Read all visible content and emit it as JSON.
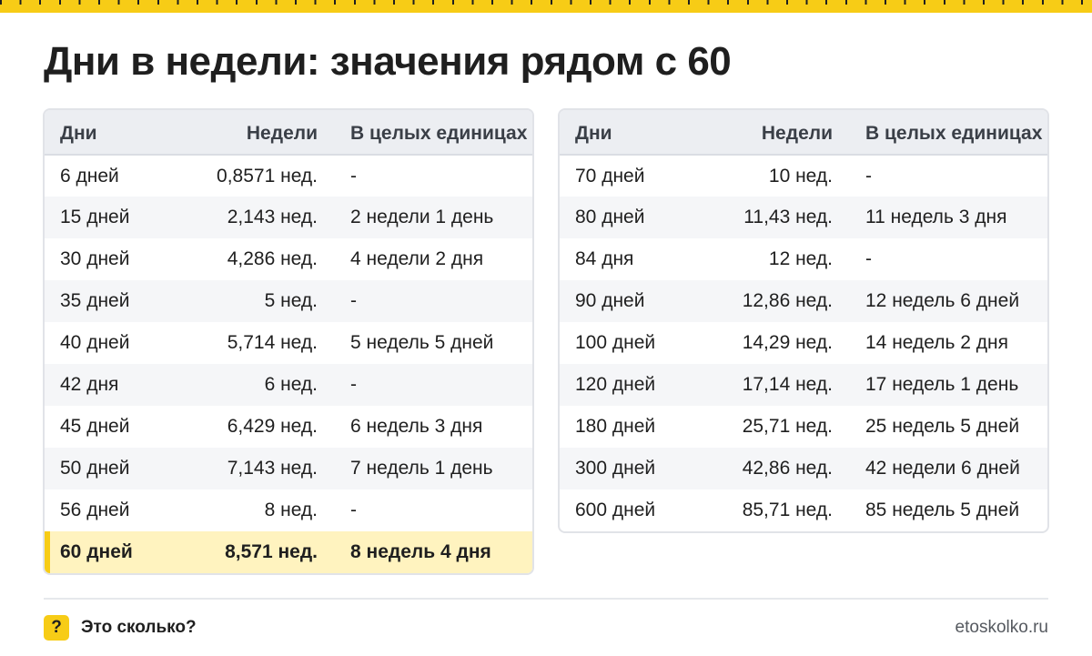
{
  "title": "Дни в недели: значения рядом с 60",
  "headers": [
    "Дни",
    "Недели",
    "В целых единицах"
  ],
  "left_rows": [
    [
      "6 дней",
      "0,8571 нед.",
      "-"
    ],
    [
      "15 дней",
      "2,143 нед.",
      "2 недели 1 день"
    ],
    [
      "30 дней",
      "4,286 нед.",
      "4 недели 2 дня"
    ],
    [
      "35 дней",
      "5 нед.",
      "-"
    ],
    [
      "40 дней",
      "5,714 нед.",
      "5 недель 5 дней"
    ],
    [
      "42 дня",
      "6 нед.",
      "-"
    ],
    [
      "45 дней",
      "6,429 нед.",
      "6 недель 3 дня"
    ],
    [
      "50 дней",
      "7,143 нед.",
      "7 недель 1 день"
    ],
    [
      "56 дней",
      "8 нед.",
      "-"
    ],
    [
      "60 дней",
      "8,571 нед.",
      "8 недель 4 дня"
    ]
  ],
  "right_rows": [
    [
      "70 дней",
      "10 нед.",
      "-"
    ],
    [
      "80 дней",
      "11,43 нед.",
      "11 недель 3 дня"
    ],
    [
      "84 дня",
      "12 нед.",
      "-"
    ],
    [
      "90 дней",
      "12,86 нед.",
      "12 недель 6 дней"
    ],
    [
      "100 дней",
      "14,29 нед.",
      "14 недель 2 дня"
    ],
    [
      "120 дней",
      "17,14 нед.",
      "17 недель 1 день"
    ],
    [
      "180 дней",
      "25,71 нед.",
      "25 недель 5 дней"
    ],
    [
      "300 дней",
      "42,86 нед.",
      "42 недели 6 дней"
    ],
    [
      "600 дней",
      "85,71 нед.",
      "85 недель 5 дней"
    ]
  ],
  "highlight_row": "60 дней",
  "footer": {
    "badge": "?",
    "brand": "Это сколько?",
    "site": "etoskolko.ru"
  },
  "colors": {
    "accent": "#f7cc16",
    "highlight_bg": "#fff3bf",
    "header_bg": "#eceef2",
    "stripe_bg": "#f5f6f8"
  }
}
